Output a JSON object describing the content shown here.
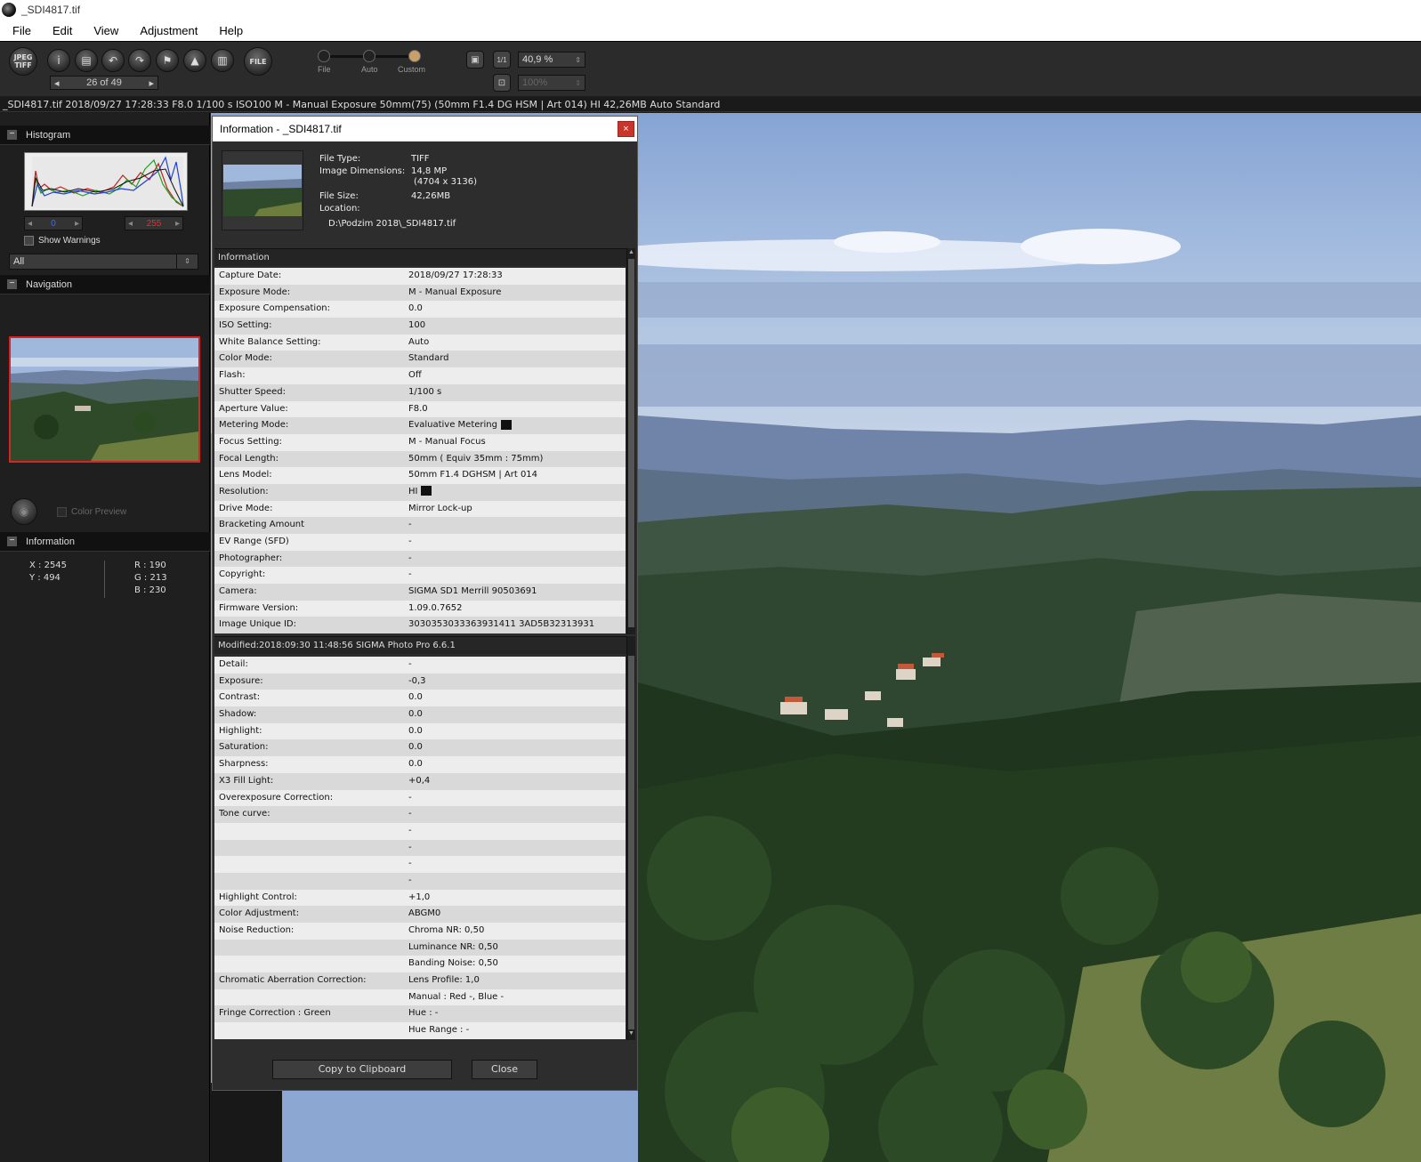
{
  "window": {
    "title": "_SDI4817.tif"
  },
  "menu": [
    "File",
    "Edit",
    "View",
    "Adjustment",
    "Help"
  ],
  "toolbar": {
    "counter": "26 of 49",
    "slider_labels": [
      "File",
      "Auto",
      "Custom"
    ],
    "zoom": "40,9 %",
    "zoom2": "100%",
    "fit_label": "1/1",
    "jpeg_tiff_icon": "JPEG TIFF",
    "file_icon": "FILE"
  },
  "status_line": "_SDI4817.tif 2018/09/27 17:28:33 F8.0 1/100 s ISO100 M - Manual Exposure 50mm(75) (50mm F1.4 DG HSM | Art 014) HI 42,26MB Auto Standard",
  "left": {
    "histogram_title": "Histogram",
    "hist_low": "0",
    "hist_high": "255",
    "show_warnings": "Show Warnings",
    "select_all": "All",
    "navigation_title": "Navigation",
    "color_preview": "Color Preview",
    "information_title": "Information",
    "x": "X : 2545",
    "y": "Y : 494",
    "r": "R :  190",
    "g": "G :  213",
    "b": "B :  230"
  },
  "dialog": {
    "title": "Information - _SDI4817.tif",
    "close_x": "×",
    "file_type_label": "File Type:",
    "file_type": "TIFF",
    "dims_label": "Image Dimensions:",
    "dims": "14,8 MP",
    "dims2": "(4704 x 3136)",
    "size_label": "File Size:",
    "size": "42,26MB",
    "location_label": "Location:",
    "location": "D:\\Podzim 2018\\_SDI4817.tif",
    "info_section": "Information",
    "info_rows": [
      [
        "Capture Date:",
        "2018/09/27 17:28:33"
      ],
      [
        "Exposure Mode:",
        "M - Manual Exposure"
      ],
      [
        "Exposure Compensation:",
        "0.0"
      ],
      [
        "ISO Setting:",
        "100"
      ],
      [
        "White Balance Setting:",
        "Auto"
      ],
      [
        "Color Mode:",
        "Standard"
      ],
      [
        "Flash:",
        "Off"
      ],
      [
        "Shutter Speed:",
        "1/100 s"
      ],
      [
        "Aperture Value:",
        "F8.0"
      ],
      [
        "Metering Mode:",
        "Evaluative Metering"
      ],
      [
        "Focus Setting:",
        "M - Manual Focus"
      ],
      [
        "Focal Length:",
        "50mm ( Equiv 35mm : 75mm)"
      ],
      [
        "Lens Model:",
        "50mm F1.4 DGHSM | Art 014"
      ],
      [
        "Resolution:",
        "HI"
      ],
      [
        "Drive Mode:",
        "Mirror Lock-up"
      ],
      [
        "Bracketing Amount",
        "-"
      ],
      [
        "EV Range (SFD)",
        "-"
      ],
      [
        "Photographer:",
        "-"
      ],
      [
        "Copyright:",
        "-"
      ],
      [
        "Camera:",
        "SIGMA SD1 Merrill 90503691"
      ],
      [
        "Firmware Version:",
        "1.09.0.7652"
      ],
      [
        "Image Unique ID:",
        "3030353033363931411 3AD5B32313931"
      ]
    ],
    "modified_section": "Modified:2018:09:30 11:48:56 SIGMA Photo Pro 6.6.1",
    "mod_rows": [
      [
        "Detail:",
        "-"
      ],
      [
        "Exposure:",
        "-0,3"
      ],
      [
        "Contrast:",
        "0.0"
      ],
      [
        "Shadow:",
        "0.0"
      ],
      [
        "Highlight:",
        "0.0"
      ],
      [
        "Saturation:",
        "0.0"
      ],
      [
        "Sharpness:",
        "0.0"
      ],
      [
        "X3 Fill Light:",
        "+0,4"
      ],
      [
        "Overexposure Correction:",
        "-"
      ],
      [
        "Tone curve:",
        "-"
      ],
      [
        "",
        "-"
      ],
      [
        "",
        "-"
      ],
      [
        "",
        "-"
      ],
      [
        "",
        "-"
      ],
      [
        "Highlight Control:",
        "+1,0"
      ],
      [
        "Color Adjustment:",
        "ABGM0"
      ],
      [
        "Noise Reduction:",
        "Chroma NR: 0,50"
      ],
      [
        "",
        "Luminance NR: 0,50"
      ],
      [
        "",
        "Banding Noise: 0,50"
      ],
      [
        "Chromatic Aberration Correction:",
        "Lens Profile: 1,0"
      ],
      [
        "",
        "Manual : Red -, Blue -"
      ],
      [
        "Fringe Correction : Green",
        "Hue : -"
      ],
      [
        "",
        "Hue Range : -"
      ]
    ],
    "copy_button": "Copy to Clipboard",
    "close_button": "Close"
  }
}
